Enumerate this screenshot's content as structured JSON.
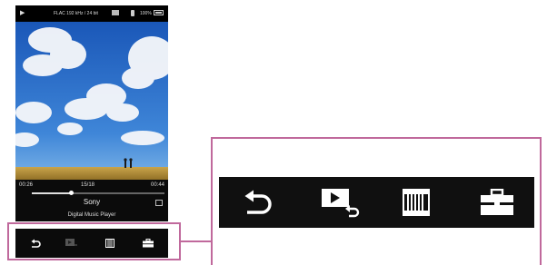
{
  "status_bar": {
    "play_state_icon": "play-icon",
    "format_text": "FLAC 192 kHz / 24 bit",
    "battery_text": "100%"
  },
  "now_playing": {
    "elapsed": "00:26",
    "track_position": "15/18",
    "total": "00:44",
    "progress": 0.3,
    "song_title": "Sony",
    "artist": "Digital Music Player"
  },
  "toolbar_buttons": [
    {
      "name": "back-button",
      "icon": "back-arrow-icon"
    },
    {
      "name": "play-mode-button",
      "icon": "play-return-icon"
    },
    {
      "name": "library-button",
      "icon": "library-grid-icon"
    },
    {
      "name": "options-button",
      "icon": "toolbox-icon"
    }
  ],
  "colors": {
    "highlight": "#c0699c",
    "toolbar_bg": "#101010",
    "icon": "#ffffff"
  }
}
